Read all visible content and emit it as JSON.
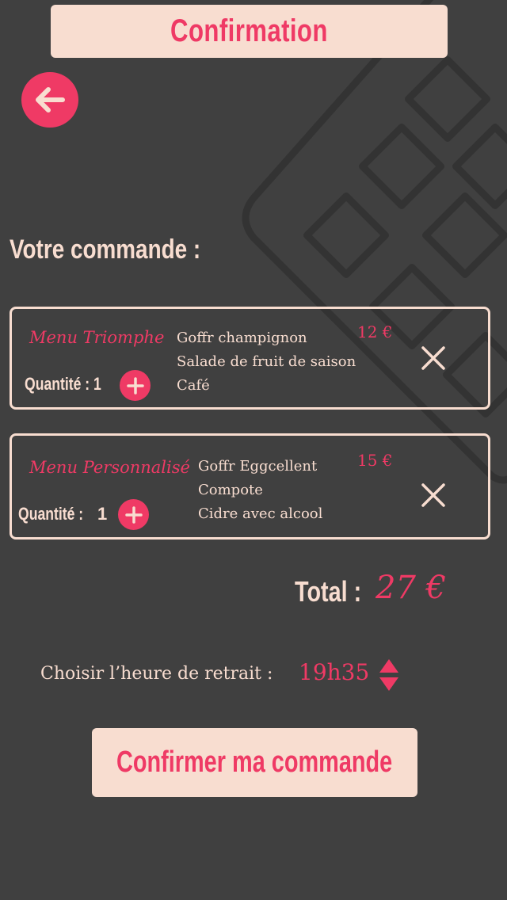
{
  "header": {
    "title": "Confirmation",
    "back_icon": "arrow-left-icon"
  },
  "order_section": {
    "heading": "Votre commande :"
  },
  "orders": [
    {
      "menu_name": "Menu Triomphe",
      "quantity_label": "Quantité : 1",
      "quantity_value": "",
      "items": [
        "Goffr champignon",
        "Salade de fruit de saison",
        "Café"
      ],
      "price": "12 €"
    },
    {
      "menu_name": "Menu Personnalisé",
      "quantity_label": "Quantité :",
      "quantity_value": "1",
      "items": [
        "Goffr Eggcellent",
        "Compote",
        "Cidre avec alcool"
      ],
      "price": "15 €"
    }
  ],
  "total": {
    "label": "Total :",
    "value": "27 €"
  },
  "pickup": {
    "label": "Choisir l’heure de retrait :",
    "time": "19h35"
  },
  "confirm_button": {
    "label": "Confirmer ma commande"
  },
  "colors": {
    "background": "#404040",
    "accent": "#ef3a65",
    "cream": "#f8ddd0"
  }
}
